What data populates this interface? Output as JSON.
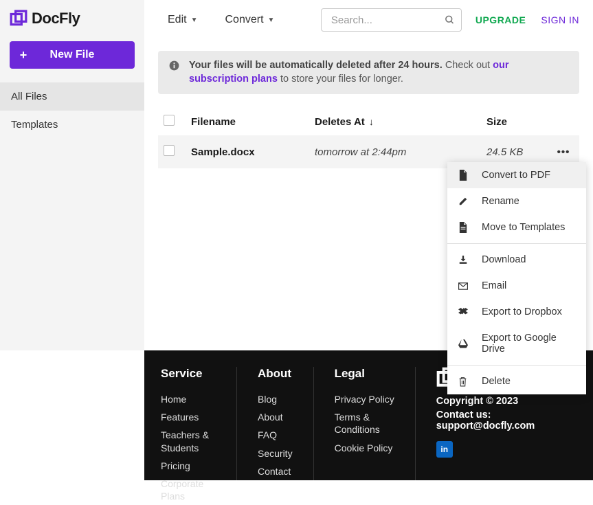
{
  "brand": "DocFly",
  "sidebar": {
    "new_file": "New File",
    "items": [
      "All Files",
      "Templates"
    ]
  },
  "topbar": {
    "edit": "Edit",
    "convert": "Convert",
    "search_placeholder": "Search...",
    "upgrade": "UPGRADE",
    "signin": "SIGN IN"
  },
  "notice": {
    "prefix": "Your files will be automatically deleted after 24 hours.",
    "checkout": "Check out",
    "link": "our subscription plans",
    "suffix": "to store your files for longer."
  },
  "table": {
    "headers": {
      "filename": "Filename",
      "deletes": "Deletes At",
      "size": "Size"
    },
    "rows": [
      {
        "filename": "Sample.docx",
        "deletes": "tomorrow at 2:44pm",
        "size": "24.5 KB"
      }
    ]
  },
  "menu": {
    "convert_pdf": "Convert to PDF",
    "rename": "Rename",
    "move_templates": "Move to Templates",
    "download": "Download",
    "email": "Email",
    "export_dropbox": "Export to Dropbox",
    "export_gdrive": "Export to Google Drive",
    "delete": "Delete"
  },
  "footer": {
    "service": {
      "heading": "Service",
      "links": [
        "Home",
        "Features",
        "Teachers & Students",
        "Pricing",
        "Corporate Plans"
      ]
    },
    "about": {
      "heading": "About",
      "links": [
        "Blog",
        "About",
        "FAQ",
        "Security",
        "Contact"
      ]
    },
    "legal": {
      "heading": "Legal",
      "links": [
        "Privacy Policy",
        "Terms & Conditions",
        "Cookie Policy"
      ]
    },
    "copyright": "Copyright © 2023",
    "support": "Contact us: support@docfly.com",
    "linkedin": "in"
  }
}
